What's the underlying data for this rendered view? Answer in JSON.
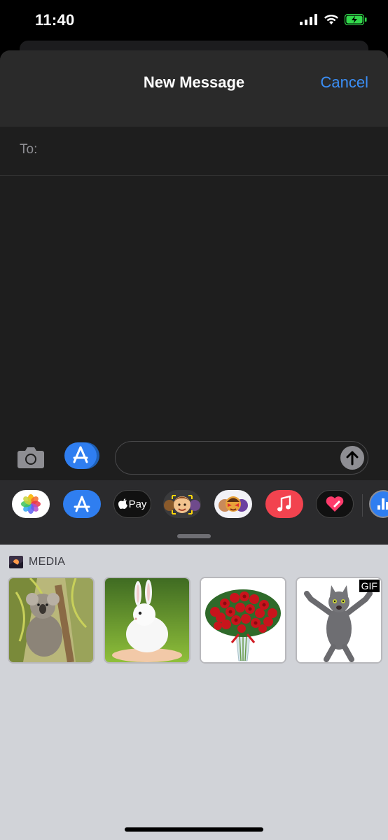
{
  "status_bar": {
    "time": "11:40",
    "signal_icon": "signal-bars-icon",
    "wifi_icon": "wifi-icon",
    "battery_icon": "battery-charging-icon"
  },
  "nav": {
    "title": "New Message",
    "cancel_label": "Cancel"
  },
  "recipient": {
    "label": "To:"
  },
  "compose": {
    "message_value": "",
    "camera_icon": "camera-icon",
    "apps_icon": "app-store-icon",
    "send_icon": "send-arrow-icon"
  },
  "app_strip": {
    "apps": [
      {
        "name": "Photos",
        "icon": "photos-icon"
      },
      {
        "name": "App Store",
        "icon": "app-store-icon"
      },
      {
        "name": "Apple Pay",
        "icon": "apple-pay-icon",
        "label": "Pay"
      },
      {
        "name": "Memoji",
        "icon": "memoji-icon"
      },
      {
        "name": "Memoji Stickers",
        "icon": "memoji-stickers-icon"
      },
      {
        "name": "Music",
        "icon": "music-icon"
      },
      {
        "name": "Digital Touch",
        "icon": "digital-touch-icon"
      },
      {
        "name": "More",
        "icon": "more-apps-icon"
      }
    ]
  },
  "media": {
    "label": "MEDIA",
    "items": [
      {
        "subject": "koala",
        "gif": false
      },
      {
        "subject": "white rabbit",
        "gif": false
      },
      {
        "subject": "bouquet of red roses",
        "gif": false
      },
      {
        "subject": "dancing cat",
        "gif": true,
        "badge": "GIF"
      }
    ]
  },
  "colors": {
    "accent": "#3b8ff7",
    "sheet": "#1e1e1e",
    "drawer": "#d1d3d8"
  }
}
